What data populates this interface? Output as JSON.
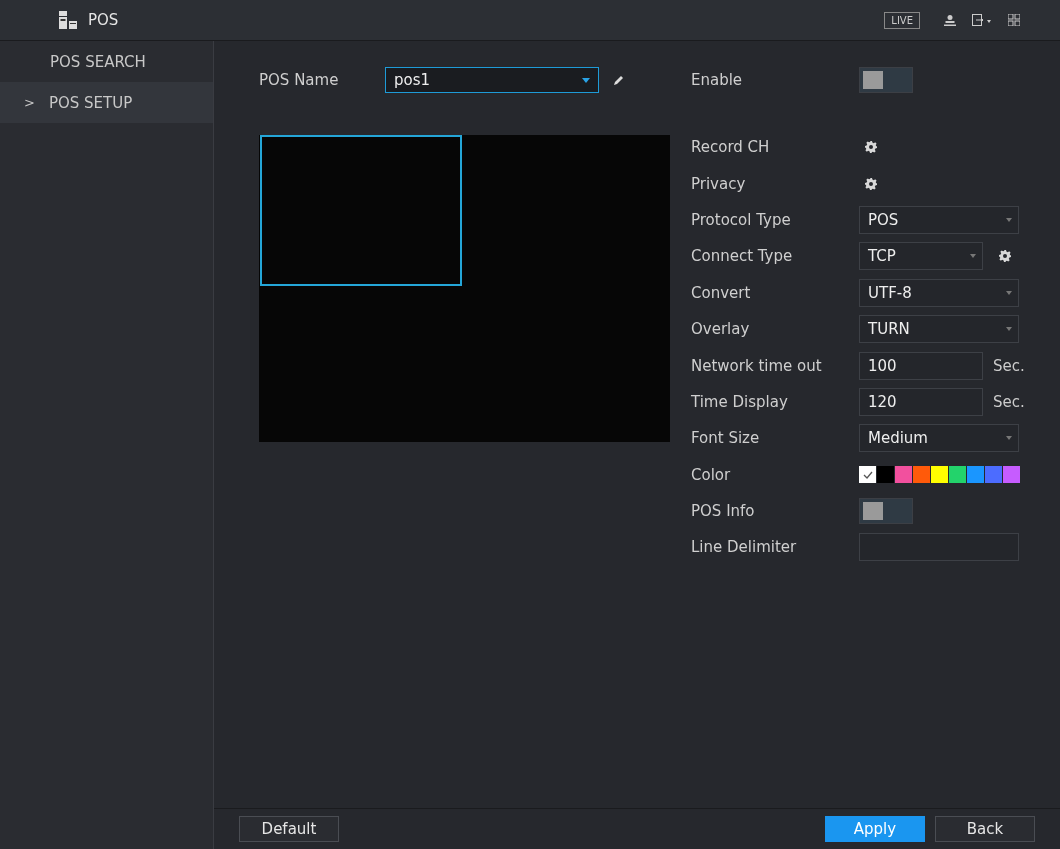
{
  "header": {
    "title": "POS",
    "live_button": "LIVE"
  },
  "sidebar": {
    "items": [
      {
        "label": "POS SEARCH",
        "selected": false
      },
      {
        "label": "POS SETUP",
        "selected": true,
        "arrow": ">"
      }
    ]
  },
  "pos_name": {
    "label": "POS Name",
    "value": "pos1"
  },
  "enable": {
    "label": "Enable",
    "on": false
  },
  "settings": [
    {
      "kind": "gear",
      "label": "Record CH"
    },
    {
      "kind": "gear",
      "label": "Privacy"
    },
    {
      "kind": "select",
      "label": "Protocol Type",
      "value": "POS"
    },
    {
      "kind": "select_gear",
      "label": "Connect Type",
      "value": "TCP"
    },
    {
      "kind": "select",
      "label": "Convert",
      "value": "UTF-8"
    },
    {
      "kind": "select",
      "label": "Overlay",
      "value": "TURN"
    },
    {
      "kind": "text_unit",
      "label": "Network time out",
      "value": "100",
      "unit": "Sec."
    },
    {
      "kind": "text_unit",
      "label": "Time Display",
      "value": "120",
      "unit": "Sec."
    },
    {
      "kind": "select",
      "label": "Font Size",
      "value": "Medium"
    },
    {
      "kind": "colors",
      "label": "Color",
      "colors": [
        {
          "color": "#ffffff",
          "selected": true
        },
        {
          "color": "#000000",
          "selected": false
        },
        {
          "color": "#f2509e",
          "selected": false
        },
        {
          "color": "#ff5a0a",
          "selected": false
        },
        {
          "color": "#ffff00",
          "selected": false
        },
        {
          "color": "#23d36b",
          "selected": false
        },
        {
          "color": "#1a96ff",
          "selected": false
        },
        {
          "color": "#4c6cff",
          "selected": false
        },
        {
          "color": "#c65cff",
          "selected": false
        }
      ]
    },
    {
      "kind": "toggle",
      "label": "POS Info",
      "on": false
    },
    {
      "kind": "text",
      "label": "Line Delimiter"
    }
  ],
  "buttons": {
    "default": "Default",
    "apply": "Apply",
    "back": "Back"
  }
}
